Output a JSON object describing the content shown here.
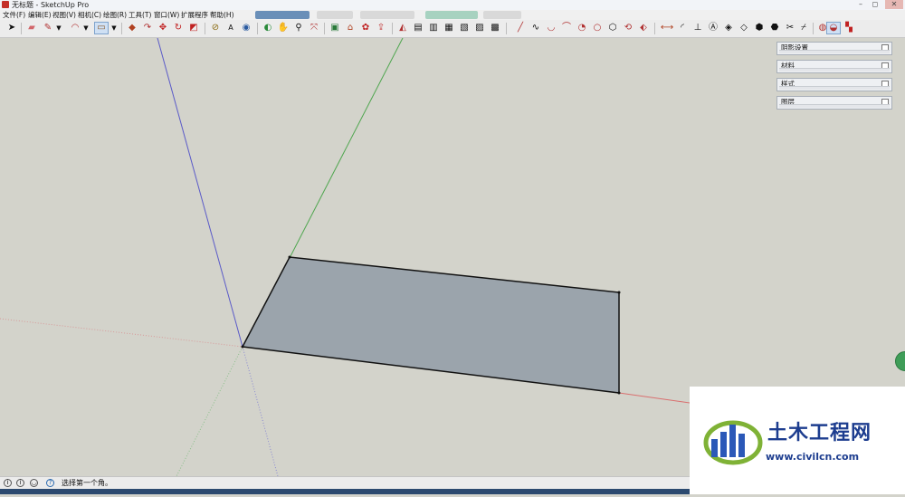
{
  "window": {
    "title": "无标题 - SketchUp Pro"
  },
  "menu": {
    "items": [
      "文件(F)",
      "编辑(E)",
      "视图(V)",
      "相机(C)",
      "绘图(R)",
      "工具(T)",
      "窗口(W)",
      "扩展程序",
      "帮助(H)"
    ]
  },
  "toolbar": {
    "icons": [
      "select-arrow-icon",
      "eraser-icon",
      "pencil-line-icon",
      "dropdown-arrow-icon",
      "arc-icon",
      "dropdown-arrow-icon",
      "rectangle-icon",
      "dropdown-arrow-icon",
      "push-pull-icon",
      "follow-me-icon",
      "move-icon",
      "rotate-icon",
      "scale-icon",
      "tape-measure-icon",
      "text-label-icon",
      "paint-bucket-icon",
      "orbit-icon",
      "pan-icon",
      "zoom-icon",
      "zoom-extents-icon",
      "component-icon",
      "warehouse-icon",
      "extension-warehouse-icon",
      "send-to-layout-icon",
      "sandbox-smoove-icon",
      "sandbox-stamp-icon",
      "sandbox-drape-icon",
      "sandbox-detail-icon",
      "sandbox-flip-icon",
      "sandbox-contour-icon",
      "sandbox-grid-icon",
      "line-icon",
      "freehand-icon",
      "arc-2pt-icon",
      "arc-3pt-icon",
      "pie-icon",
      "circle-icon",
      "polygon-icon",
      "offset-icon",
      "section-plane-icon",
      "dimension-icon",
      "protractor-icon",
      "axes-icon",
      "3d-text-icon",
      "solid-outer-shell-icon",
      "solid-intersect-icon",
      "solid-union-icon",
      "solid-subtract-icon",
      "solid-trim-icon",
      "solid-split-icon",
      "style-xray-icon",
      "style-backedges-icon",
      "style-wireframe-icon",
      "style-hidden-line-icon",
      "style-shaded-icon"
    ]
  },
  "trays": [
    {
      "label": "阴影设置"
    },
    {
      "label": "材料"
    },
    {
      "label": "样式"
    },
    {
      "label": "图层"
    }
  ],
  "statusbar": {
    "message": "选择第一个角。"
  },
  "watermark": {
    "brand": "土木工程网",
    "url": "www.civilcn.com"
  },
  "colors": {
    "background": "#d3d3cb",
    "face_fill": "#9ba4ac",
    "red_axis": "#d97070",
    "green_axis": "#4fa64f",
    "blue_axis": "#5a5ac8",
    "brand_blue": "#1d3d8f"
  }
}
